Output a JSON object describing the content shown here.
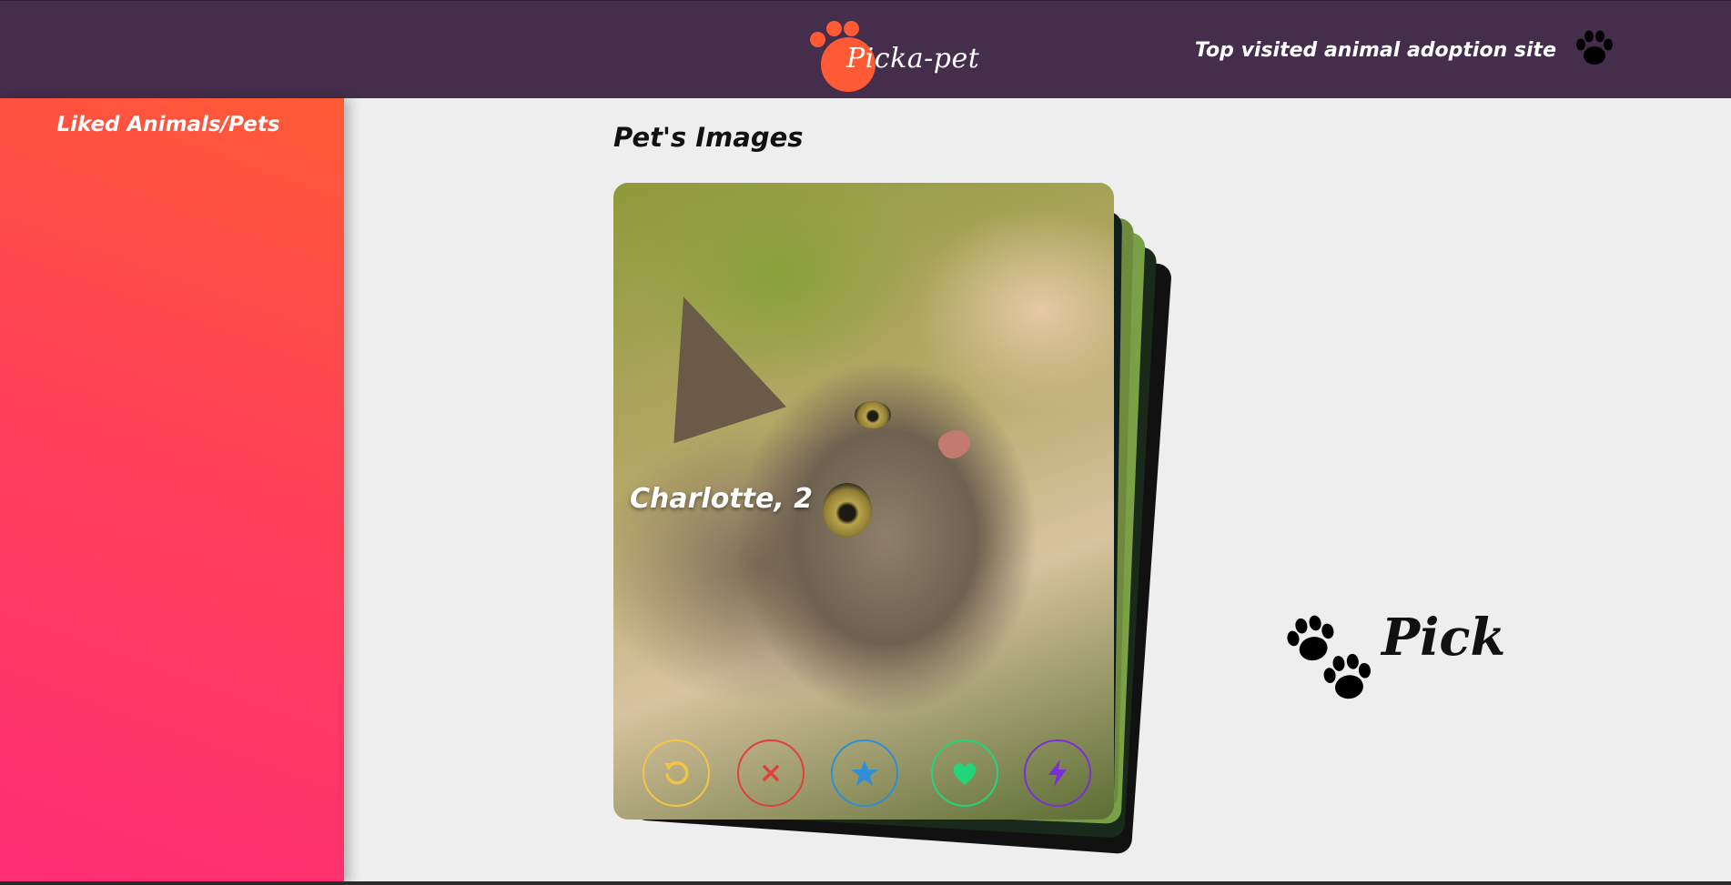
{
  "header": {
    "logo_text": "Picka-pet",
    "tagline": "Top visited animal adoption site",
    "paw_icon": "paw-icon"
  },
  "sidebar": {
    "title": "Liked Animals/Pets"
  },
  "main": {
    "title": "Pet's Images",
    "card": {
      "name": "Charlotte,  2"
    },
    "actions": [
      {
        "name": "undo",
        "icon": "undo-icon",
        "color": "#f5c542"
      },
      {
        "name": "nope",
        "icon": "close-icon",
        "color": "#e0403c"
      },
      {
        "name": "super-like",
        "icon": "star-icon",
        "color": "#2e8ed6"
      },
      {
        "name": "like",
        "icon": "heart-icon",
        "color": "#23d47a"
      },
      {
        "name": "boost",
        "icon": "lightning-icon",
        "color": "#7b2fd6"
      }
    ]
  },
  "brand": {
    "pick_text": "Pick"
  },
  "colors": {
    "header_bg": "#452e4c",
    "sidebar_gradient_top": "#ff5a36",
    "sidebar_gradient_bottom": "#ff2d76",
    "page_bg": "#eeeeee"
  }
}
